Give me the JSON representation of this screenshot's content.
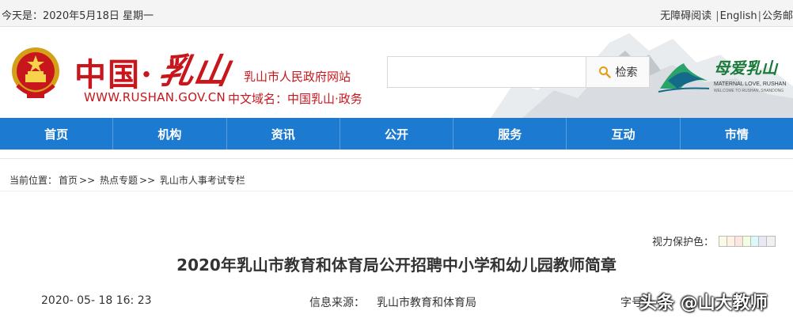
{
  "topbar": {
    "date": "今天是：2020年5月18日 星期一",
    "accessibility": "无障碍阅读",
    "english": "English",
    "mail": "公务邮"
  },
  "header": {
    "brand_cn": "中国·",
    "brand_rushan": "乳山",
    "site_name": "乳山市人民政府网站",
    "url": "WWW.RUSHAN.GOV.CN",
    "domain": "中文域名：中国乳山·政务",
    "search_placeholder": "",
    "search_label": "检索",
    "logo_title": "母爱乳山",
    "logo_en": "MATERNAL LOVE, RUSHAN",
    "logo_en_small": "WELCOME TO RUSHAN, SHANDONG"
  },
  "nav": {
    "items": [
      "首页",
      "机构",
      "资讯",
      "公开",
      "服务",
      "互动",
      "市情"
    ]
  },
  "breadcrumb": {
    "label": "当前位置：",
    "home": "首页",
    "sep1": ">>",
    "topic": "热点专题",
    "sep2": ">>",
    "current": "乳山市人事考试专栏"
  },
  "eye_protect": {
    "label": "视力保护色：",
    "colors": [
      "#fafbe6",
      "#fff2e2",
      "#fde6e0",
      "#f3ffe1",
      "#dafaf5",
      "#eae8f7",
      "#f0f0f0"
    ]
  },
  "article": {
    "title": "2020年乳山市教育和体育局公开招聘中小学和幼儿园教师简章",
    "date": "2020- 05- 18 16: 23",
    "source_label": "信息来源：",
    "source": "乳山市教育和体育局",
    "fontsize_label": "字号"
  },
  "watermark": "头条 @山大教师",
  "colors": {
    "brand_red": "#c8161d",
    "nav_blue": "#1c7bd0",
    "logo_green": "#1a7a3a"
  }
}
